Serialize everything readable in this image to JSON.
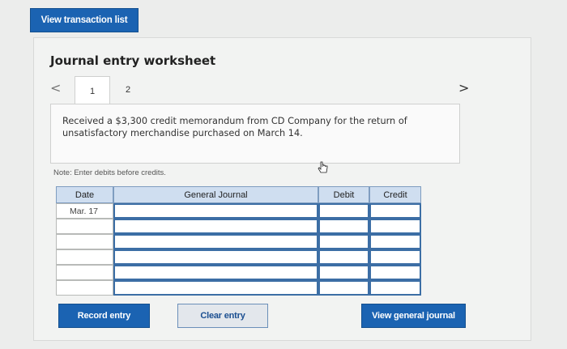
{
  "header": {
    "view_transactions_label": "View transaction list"
  },
  "worksheet": {
    "title": "Journal entry worksheet",
    "tabs": [
      {
        "label": "1"
      },
      {
        "label": "2"
      }
    ],
    "prev_icon": "chevron-left-icon",
    "next_icon": "chevron-right-icon",
    "prompt": "Received a $3,300 credit memorandum from CD Company for the return of unsatisfactory merchandise purchased on March 14.",
    "note": "Note: Enter debits before credits."
  },
  "table": {
    "columns": [
      "Date",
      "General Journal",
      "Debit",
      "Credit"
    ],
    "rows": [
      {
        "date": "Mar. 17",
        "account": "",
        "debit": "",
        "credit": ""
      },
      {
        "date": "",
        "account": "",
        "debit": "",
        "credit": ""
      },
      {
        "date": "",
        "account": "",
        "debit": "",
        "credit": ""
      },
      {
        "date": "",
        "account": "",
        "debit": "",
        "credit": ""
      },
      {
        "date": "",
        "account": "",
        "debit": "",
        "credit": ""
      },
      {
        "date": "",
        "account": "",
        "debit": "",
        "credit": ""
      }
    ]
  },
  "actions": {
    "record_entry": "Record entry",
    "clear_entry": "Clear entry",
    "view_general_journal": "View general journal"
  },
  "colors": {
    "primary": "#1b63b2",
    "header_fill": "#cfdef0",
    "input_border": "#3c6ea5",
    "background": "#ecedec"
  }
}
